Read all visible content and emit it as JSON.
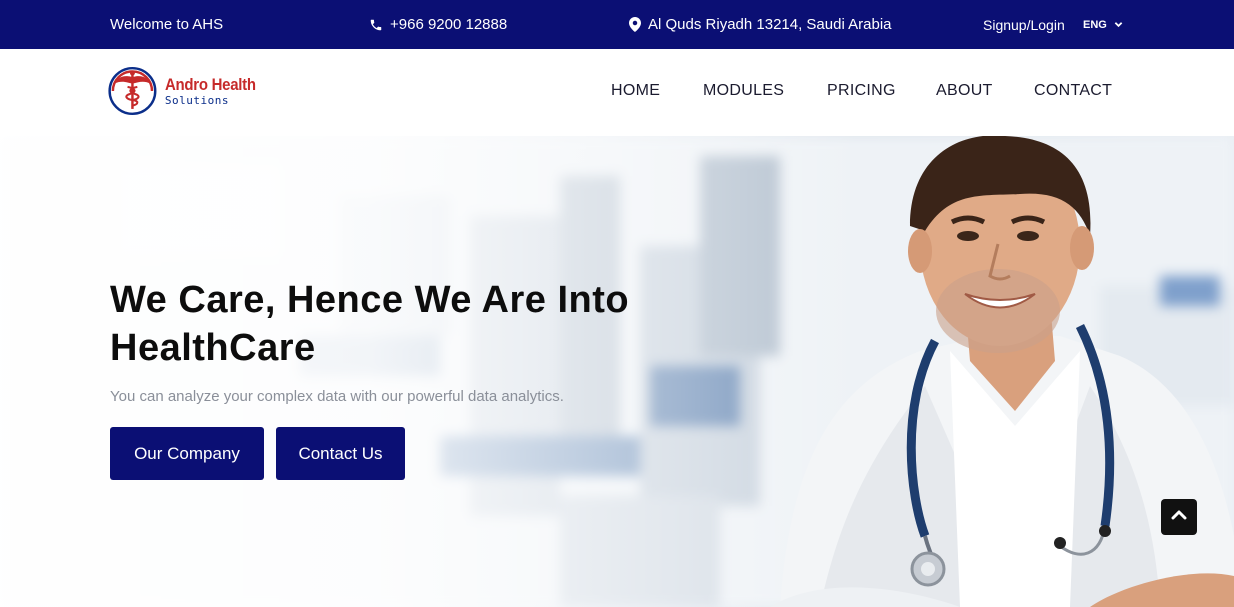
{
  "topbar": {
    "welcome": "Welcome to AHS",
    "phone": "+966 9200 12888",
    "address": "Al Quds Riyadh 13214, Saudi Arabia",
    "signup": "Signup/Login",
    "language": "ENG",
    "icons": [
      "phone-icon",
      "location-pin-icon",
      "chevron-down-icon"
    ]
  },
  "brand": {
    "name": "Andro Health",
    "sub": "Solutions"
  },
  "nav": {
    "home": "HOME",
    "modules": "MODULES",
    "pricing": "PRICING",
    "about": "ABOUT",
    "contact": "CONTACT"
  },
  "hero": {
    "title": "We Care, Hence We Are Into HealthCare",
    "subtitle": "You can analyze your complex data with our powerful data analytics.",
    "buttons": {
      "company": "Our Company",
      "contact": "Contact Us"
    }
  },
  "colors": {
    "primary": "#0b0f74",
    "brand_red": "#c62a2a",
    "brand_blue": "#0b2e8a"
  }
}
